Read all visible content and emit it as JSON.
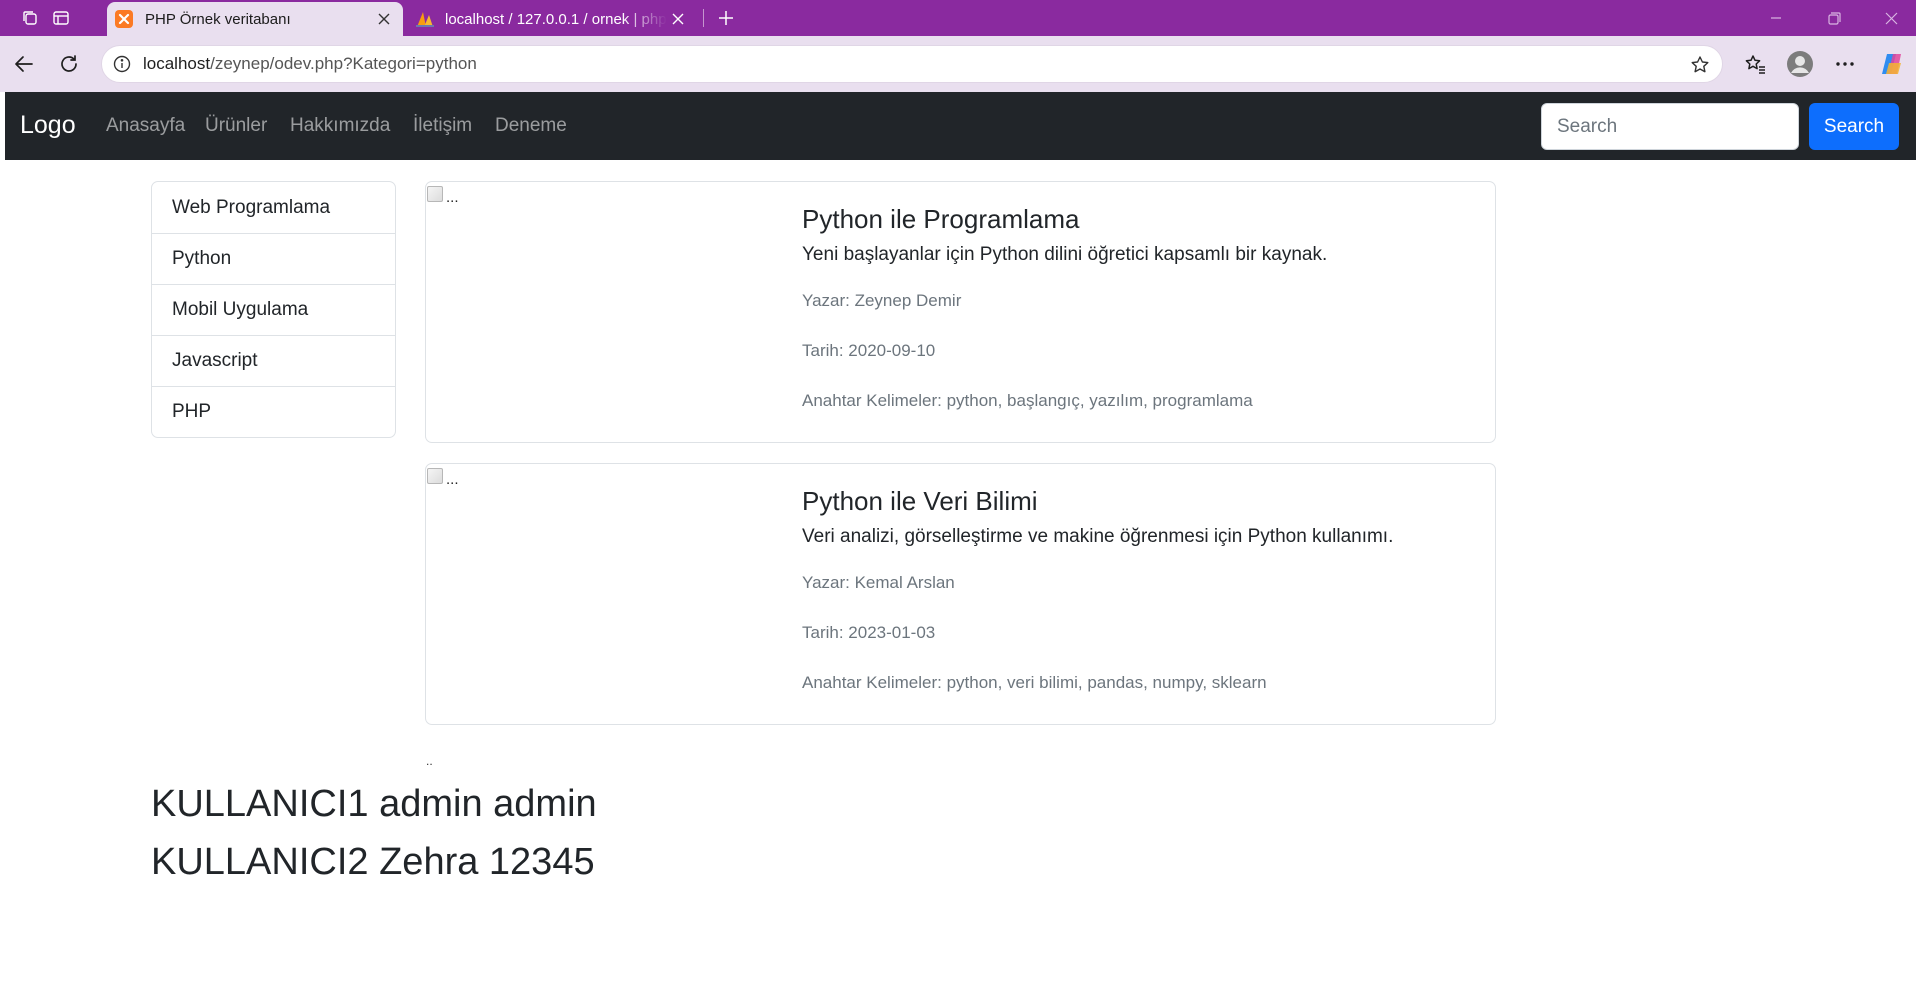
{
  "browser": {
    "tabs": [
      {
        "title": "PHP Örnek veritabanı",
        "active": true
      },
      {
        "title": "localhost / 127.0.0.1 / ornek | phpMyAdmin",
        "active": false
      }
    ],
    "url_host": "localhost",
    "url_path": "/zeynep/odev.php?Kategori=python",
    "colors": {
      "tabbar": "#8a2a9f",
      "toolbar": "#e9dfef"
    }
  },
  "navbar": {
    "brand": "Logo",
    "links": [
      "Anasayfa",
      "Ürünler",
      "Hakkımızda",
      "İletişim",
      "Deneme"
    ],
    "search_placeholder": "Search",
    "search_button": "Search"
  },
  "sidebar": {
    "items": [
      "Web Programlama",
      "Python",
      "Mobil Uygulama",
      "Javascript",
      "PHP"
    ]
  },
  "cards": [
    {
      "img_alt": "...",
      "title": "Python ile Programlama",
      "text": "Yeni başlayanlar için Python dilini öğretici kapsamlı bir kaynak.",
      "author": "Yazar: Zeynep Demir",
      "date": "Tarih: 2020-09-10",
      "keywords": "Anahtar Kelimeler: python, başlangıç, yazılım, programlama"
    },
    {
      "img_alt": "...",
      "title": "Python ile Veri Bilimi",
      "text": "Veri analizi, görselleştirme ve makine öğrenmesi için Python kullanımı.",
      "author": "Yazar: Kemal Arslan",
      "date": "Tarih: 2023-01-03",
      "keywords": "Anahtar Kelimeler: python, veri bilimi, pandas, numpy, sklearn"
    }
  ],
  "trailing_dots": "..",
  "users": [
    "KULLANICI1 admin admin",
    "KULLANICI2 Zehra 12345"
  ]
}
